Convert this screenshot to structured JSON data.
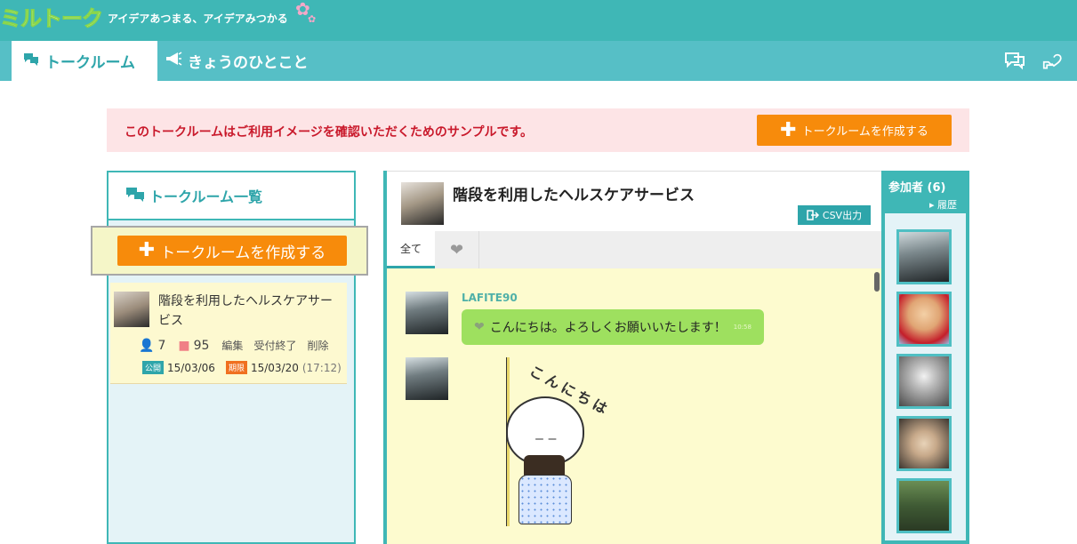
{
  "header": {
    "logo_text": "ミルトーク",
    "tagline": "アイデアあつまる、アイデアみつかる"
  },
  "nav": {
    "tabs": [
      {
        "label": "トークルーム",
        "icon": "chat-bubbles-icon",
        "active": true
      },
      {
        "label": "きょうのひとこと",
        "icon": "megaphone-icon",
        "active": false
      }
    ],
    "right_icons": [
      "chat-outline-icon",
      "heart-hand-icon"
    ]
  },
  "notice": {
    "text": "このトークルームはご利用イメージを確認いただくためのサンプルです。",
    "button_label": "トークルームを作成する"
  },
  "sidebar": {
    "title": "トークルーム一覧",
    "create_button_label": "トークルームを作成する",
    "rooms": [
      {
        "title": "階段を利用したヘルスケアサービス",
        "participants": "7",
        "comments": "95",
        "edit": "編集",
        "close_reception": "受付終了",
        "delete": "削除",
        "public_badge": "公開",
        "public_date": "15/03/06",
        "limit_badge": "期限",
        "limit_date": "15/03/20",
        "limit_time": "(17:12)"
      }
    ]
  },
  "room": {
    "title": "階段を利用したヘルスケアサービス",
    "csv_button": "CSV出力",
    "tabs": {
      "all": "全て"
    },
    "messages": [
      {
        "user": "LAFITE90",
        "text": "こんにちは。よろしくお願いいたします！",
        "sub": "10:58"
      },
      {
        "sticker_text": "こんにちは"
      }
    ]
  },
  "participants": {
    "title": "参加者 (6)",
    "history_link": "履歴"
  },
  "colors": {
    "teal": "#3fb7b6",
    "orange": "#f78b0b",
    "notice_bg": "#fde4e6",
    "notice_text": "#c9192b",
    "chat_bg": "#fdfbcf",
    "bubble": "#9ee05f"
  }
}
